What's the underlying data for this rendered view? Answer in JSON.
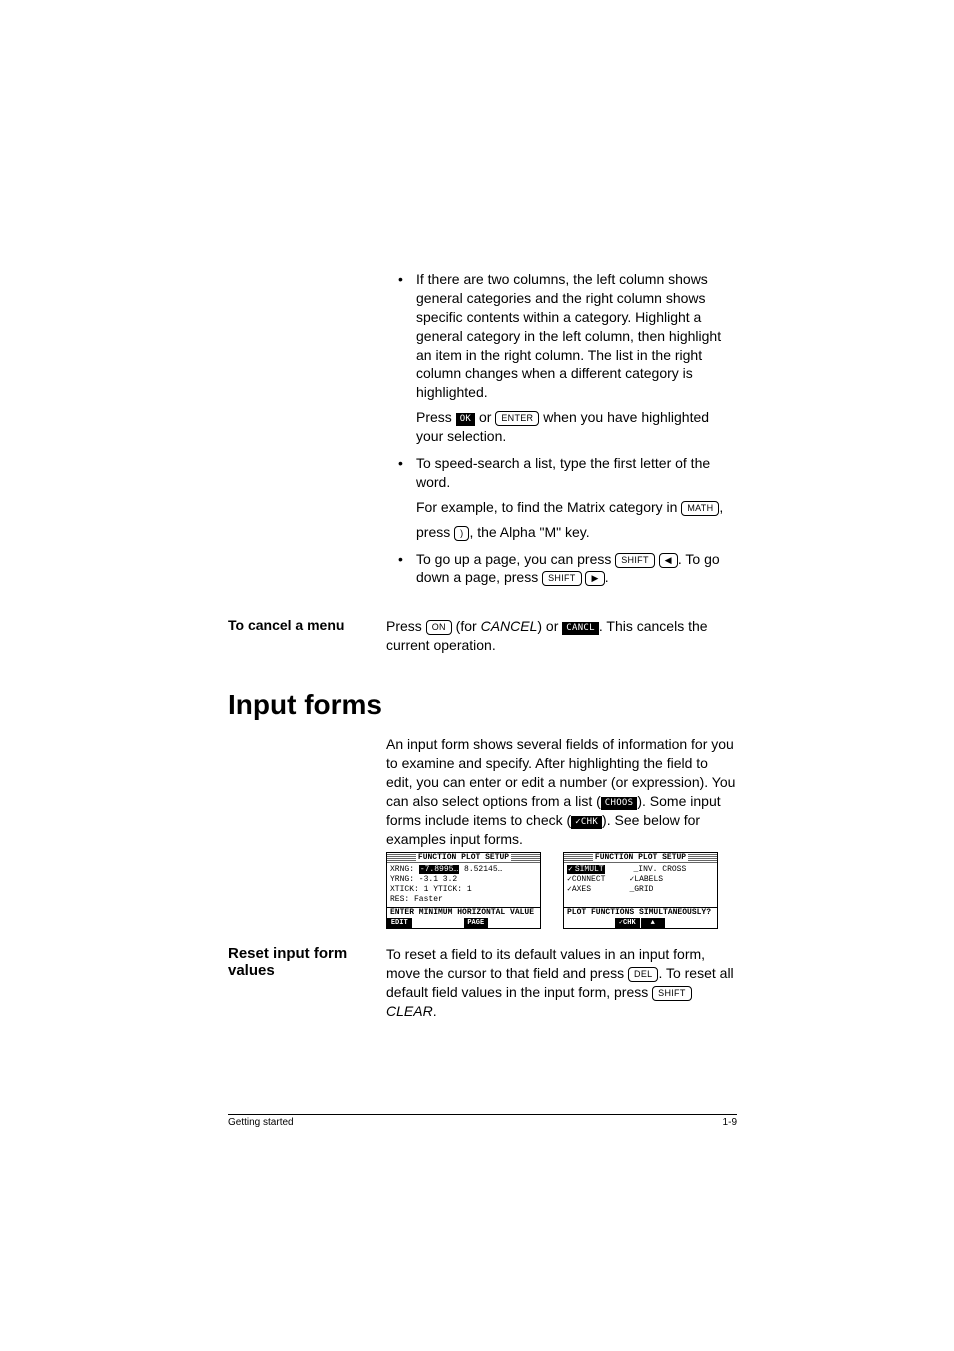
{
  "bullets": {
    "b1": {
      "p1": "If there are two columns, the left column shows general categories and the right column shows specific contents within a category. Highlight a general category in the left column, then highlight an item in the right column. The list in the right column changes when a different category is highlighted.",
      "p2a": "Press ",
      "p2_ok": "OK",
      "p2b": " or ",
      "p2_enter": "ENTER",
      "p2c": " when you have highlighted your selection."
    },
    "b2": {
      "l1": "To speed-search a list, type the first letter of the word.",
      "l2a": "For example, to find the Matrix category in ",
      "l2_math": "MATH",
      "l2b": ",",
      "l3a": "press ",
      "l3_key": ")",
      "l3b": ", the Alpha \"M\" key."
    },
    "b3": {
      "a": "To go up a page, you can press ",
      "shift": "SHIFT",
      "left": "◀",
      "b": ". To go down a page, press ",
      "right": "▶",
      "c": "."
    }
  },
  "cancel": {
    "head": "To cancel a menu",
    "a": "Press ",
    "on": "ON",
    "b": " (for ",
    "cancel_word": "CANCEL",
    "c": ") or ",
    "cancl_btn": "CANCL",
    "d": ". This cancels the current operation."
  },
  "h1": "Input forms",
  "inputforms": {
    "p1a": "An input form shows several fields of information for you to examine and specify. After highlighting the field to edit, you can enter or edit a number (or expression). You can also select options from a list (",
    "choos": "CHOOS",
    "p1b": "). Some input forms include items to check (",
    "chk": "✓CHK",
    "p1c": "). See below for examples input forms."
  },
  "calc1": {
    "title": "FUNCTION PLOT SETUP",
    "l1a": "XRNG: ",
    "l1sel": "-7.8995…",
    "l1b": " 8.52145…",
    "l2": "YRNG: -3.1      3.2",
    "l3": "XTICK: 1       YTICK: 1",
    "l4": "RES:  Faster",
    "help": "ENTER MINIMUM HORIZONTAL VALUE",
    "menu": [
      "EDIT",
      "",
      "",
      "PAGE ▼",
      "",
      ""
    ]
  },
  "calc2": {
    "title": "FUNCTION PLOT SETUP",
    "rows": [
      [
        "✓",
        "SIMULT",
        "_",
        "INV. CROSS"
      ],
      [
        "✓",
        "CONNECT",
        "✓",
        "LABELS"
      ],
      [
        "✓",
        "AXES",
        "_",
        "GRID"
      ]
    ],
    "help": "PLOT FUNCTIONS SIMULTANEOUSLY?",
    "menu": [
      "",
      "",
      "✓CHK",
      "▲ PAGE",
      "",
      ""
    ]
  },
  "reset": {
    "head": "Reset input form values",
    "a": "To reset a field to its default values in an input form, move the cursor to that field and press ",
    "del": "DEL",
    "b": ". To reset all default field values in the input form, press",
    "shift": "SHIFT",
    "clear": " CLEAR",
    "c": "."
  },
  "footer": {
    "left": "Getting started",
    "right": "1-9"
  }
}
